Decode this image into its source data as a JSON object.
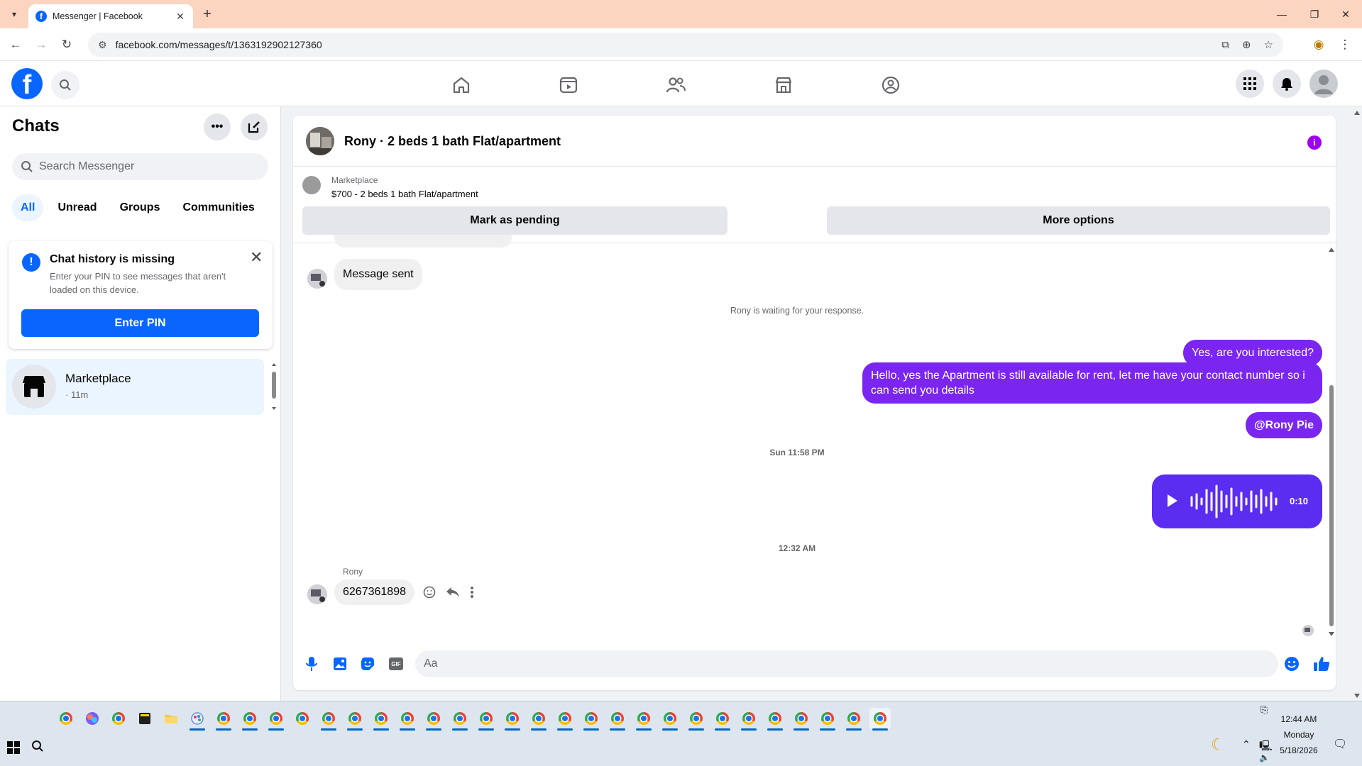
{
  "browser": {
    "tab_title": "Messenger | Facebook",
    "url": "facebook.com/messages/t/1363192902127360"
  },
  "sidebar": {
    "title": "Chats",
    "search_placeholder": "Search Messenger",
    "filters": [
      "All",
      "Unread",
      "Groups",
      "Communities"
    ],
    "notice": {
      "title": "Chat history is missing",
      "body": "Enter your PIN to see messages that aren't loaded on this device.",
      "button": "Enter PIN"
    },
    "chat_item": {
      "name": "Marketplace",
      "meta": "· 11m"
    }
  },
  "conversation": {
    "title": "Rony · 2 beds 1 bath Flat/apartment",
    "marketplace": {
      "label": "Marketplace",
      "listing": "$700 - 2 beds 1 bath Flat/apartment",
      "mark_pending": "Mark as pending",
      "more_options": "More options"
    },
    "messages": {
      "sent_notice": "Message sent",
      "waiting": "Rony is waiting for your response.",
      "out1": "Yes, are you interested?",
      "out2": "Hello, yes the Apartment is still available for rent, let me have your contact number so i can send you details",
      "out3": "@Rony Pie",
      "ts1": "Sun 11:58 PM",
      "voice_duration": "0:10",
      "ts2": "12:32 AM",
      "sender": "Rony",
      "in_phone": "6267361898"
    },
    "composer_placeholder": "Aa"
  },
  "taskbar": {
    "time": "12:44 AM",
    "day": "Monday",
    "date": "5/18/2026"
  },
  "colors": {
    "fb_blue": "#0866ff",
    "outgoing_bubble": "#7b26f0",
    "voice_bubble": "#5b2df0",
    "tab_strip": "#fbd5c0"
  }
}
